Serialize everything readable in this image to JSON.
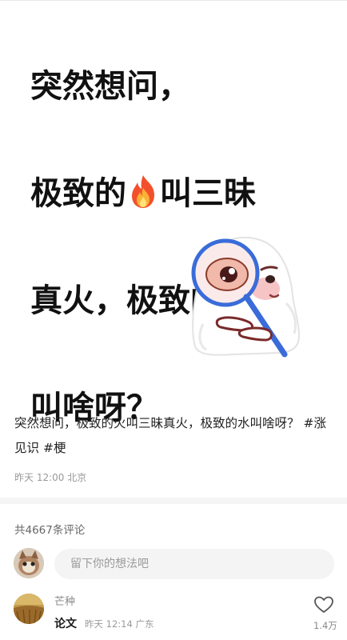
{
  "post": {
    "title_line1": "突然想问，",
    "title_line2_a": "极致的",
    "title_line2_b": "叫三昧",
    "title_line3": "真火，极致的水",
    "title_line4": "叫啥呀？",
    "text": "突然想问，极致的火叫三昧真火，极致的水叫啥呀？",
    "tag1": "#涨见识",
    "tag2": "#梗",
    "meta": "昨天 12:00 北京"
  },
  "comments": {
    "count_label": "共4667条评论",
    "input_placeholder": "留下你的想法吧",
    "items": [
      {
        "username": "芒种",
        "text": "论文",
        "meta": "昨天 12:14 广东",
        "likes": "1.4万"
      }
    ]
  },
  "icons": {
    "flame": "fire-emoji-icon",
    "like": "heart-outline-icon"
  },
  "colors": {
    "tag_text": "#222222",
    "meta_gray": "#9a9a9a",
    "input_bg": "#f4f4f4"
  }
}
